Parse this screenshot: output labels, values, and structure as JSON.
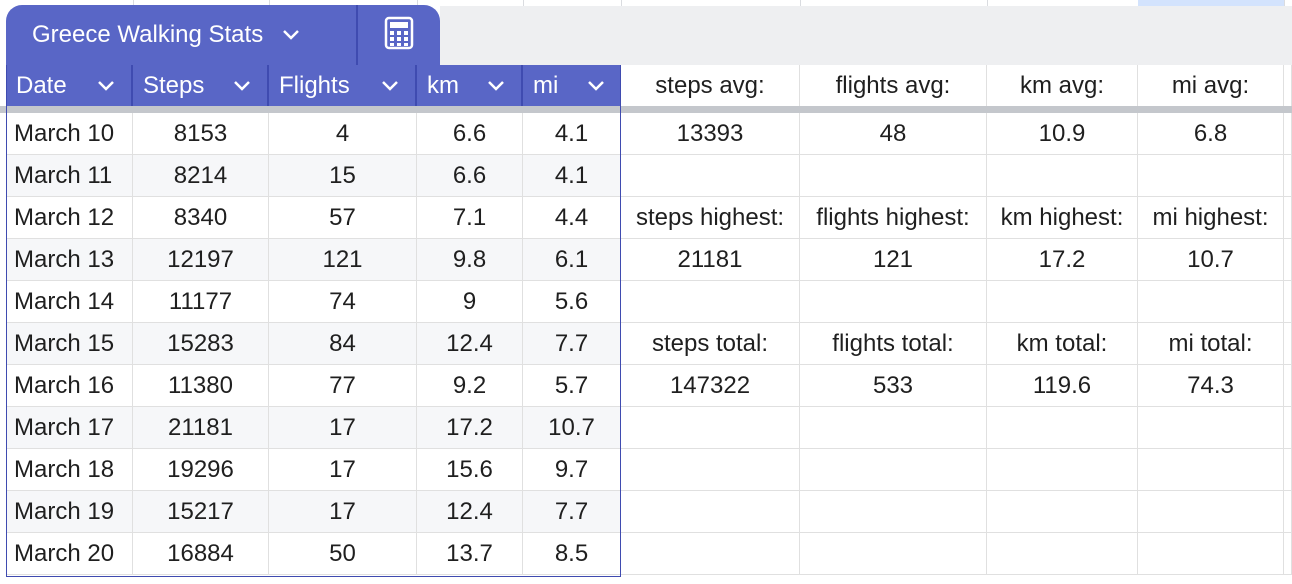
{
  "sheet": {
    "table_name": "Greece Walking Stats",
    "columns": [
      "Date",
      "Steps",
      "Flights",
      "km",
      "mi"
    ],
    "rows": [
      [
        "March 10",
        "8153",
        "4",
        "6.6",
        "4.1"
      ],
      [
        "March 11",
        "8214",
        "15",
        "6.6",
        "4.1"
      ],
      [
        "March 12",
        "8340",
        "57",
        "7.1",
        "4.4"
      ],
      [
        "March 13",
        "12197",
        "121",
        "9.8",
        "6.1"
      ],
      [
        "March 14",
        "11177",
        "74",
        "9",
        "5.6"
      ],
      [
        "March 15",
        "15283",
        "84",
        "12.4",
        "7.7"
      ],
      [
        "March 16",
        "11380",
        "77",
        "9.2",
        "5.7"
      ],
      [
        "March 17",
        "21181",
        "17",
        "17.2",
        "10.7"
      ],
      [
        "March 18",
        "19296",
        "17",
        "15.6",
        "9.7"
      ],
      [
        "March 19",
        "15217",
        "17",
        "12.4",
        "7.7"
      ],
      [
        "March 20",
        "16884",
        "50",
        "13.7",
        "8.5"
      ]
    ]
  },
  "stats": {
    "avg_labels": [
      "steps avg:",
      "flights avg:",
      "km avg:",
      "mi avg:"
    ],
    "avg_values": [
      "13393",
      "48",
      "10.9",
      "6.8"
    ],
    "highest_labels": [
      "steps highest:",
      "flights highest:",
      "km highest:",
      "mi highest:"
    ],
    "highest_values": [
      "21181",
      "121",
      "17.2",
      "10.7"
    ],
    "total_labels": [
      "steps total:",
      "flights total:",
      "km total:",
      "mi total:"
    ],
    "total_values": [
      "147322",
      "533",
      "119.6",
      "74.3"
    ]
  },
  "colors": {
    "table_header": "#5966c6",
    "accent_border": "#3f4bb0",
    "alt_row": "#f6f7f9"
  },
  "icons": {
    "tab_menu": "chevron-down-icon",
    "calculator": "calculator-icon"
  }
}
